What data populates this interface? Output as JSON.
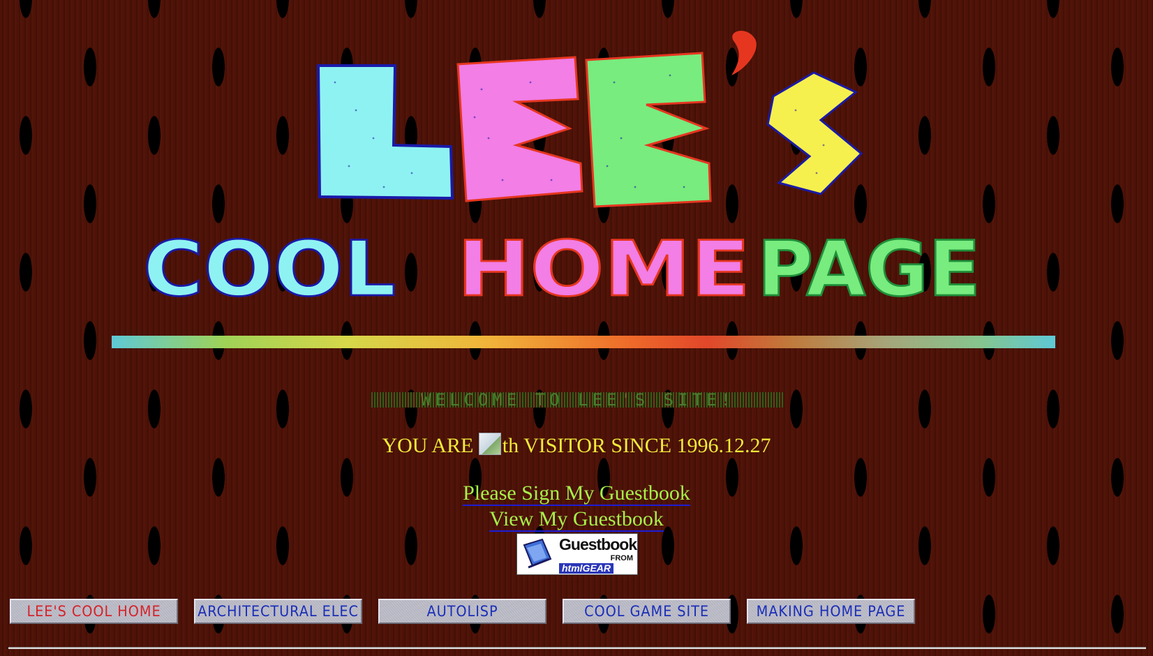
{
  "logo": {
    "line1": [
      "L",
      "E",
      "E",
      "'",
      "S"
    ],
    "line2": [
      "C",
      "O",
      "O",
      "L",
      "H",
      "O",
      "M",
      "E",
      "P",
      "A",
      "G",
      "E"
    ],
    "colors": {
      "cyan": "#8ff2f2",
      "pink": "#f27ee6",
      "green": "#78ec7e",
      "yellow": "#f6f04e",
      "red": "#e63620",
      "outline": "#1a1aa8"
    }
  },
  "marquee": {
    "text": "WELCOME TO LEE'S SITE!"
  },
  "visitor": {
    "prefix": "YOU ARE",
    "counter_alt": "th",
    "suffix": "VISITOR SINCE 1996.12.27"
  },
  "guestbook": {
    "sign_label": "Please Sign My Guestbook",
    "view_label": "View My Guestbook",
    "badge_title": "Guestbook",
    "badge_from": "FROM",
    "badge_brand": "htmlGEAR"
  },
  "nav": {
    "items": [
      {
        "label": "LEE'S COOL HOME",
        "active": true
      },
      {
        "label": "ARCHITECTURAL ELEC",
        "active": false
      },
      {
        "label": "AUTOLISP",
        "active": false
      },
      {
        "label": "COOL GAME SITE",
        "active": false
      },
      {
        "label": "MAKING HOME PAGE",
        "active": false
      }
    ]
  }
}
